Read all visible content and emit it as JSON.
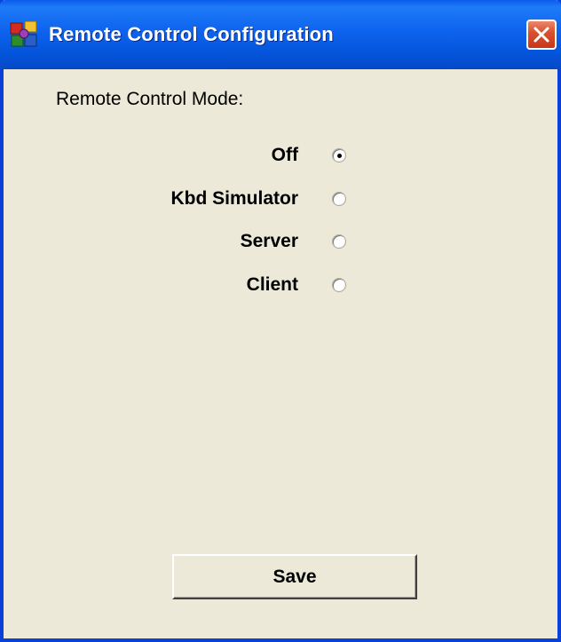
{
  "window": {
    "title": "Remote Control Configuration",
    "app_icon": "application-icon",
    "close_icon": "close-icon"
  },
  "config": {
    "mode_label": "Remote Control Mode:",
    "modes": [
      {
        "label": "Off",
        "selected": true
      },
      {
        "label": "Kbd Simulator",
        "selected": false
      },
      {
        "label": "Server",
        "selected": false
      },
      {
        "label": "Client",
        "selected": false
      }
    ]
  },
  "actions": {
    "save_label": "Save"
  },
  "colors": {
    "titlebar": "#0A5CEC",
    "window_bg": "#ECE9D8",
    "close_button": "#D9532F"
  }
}
